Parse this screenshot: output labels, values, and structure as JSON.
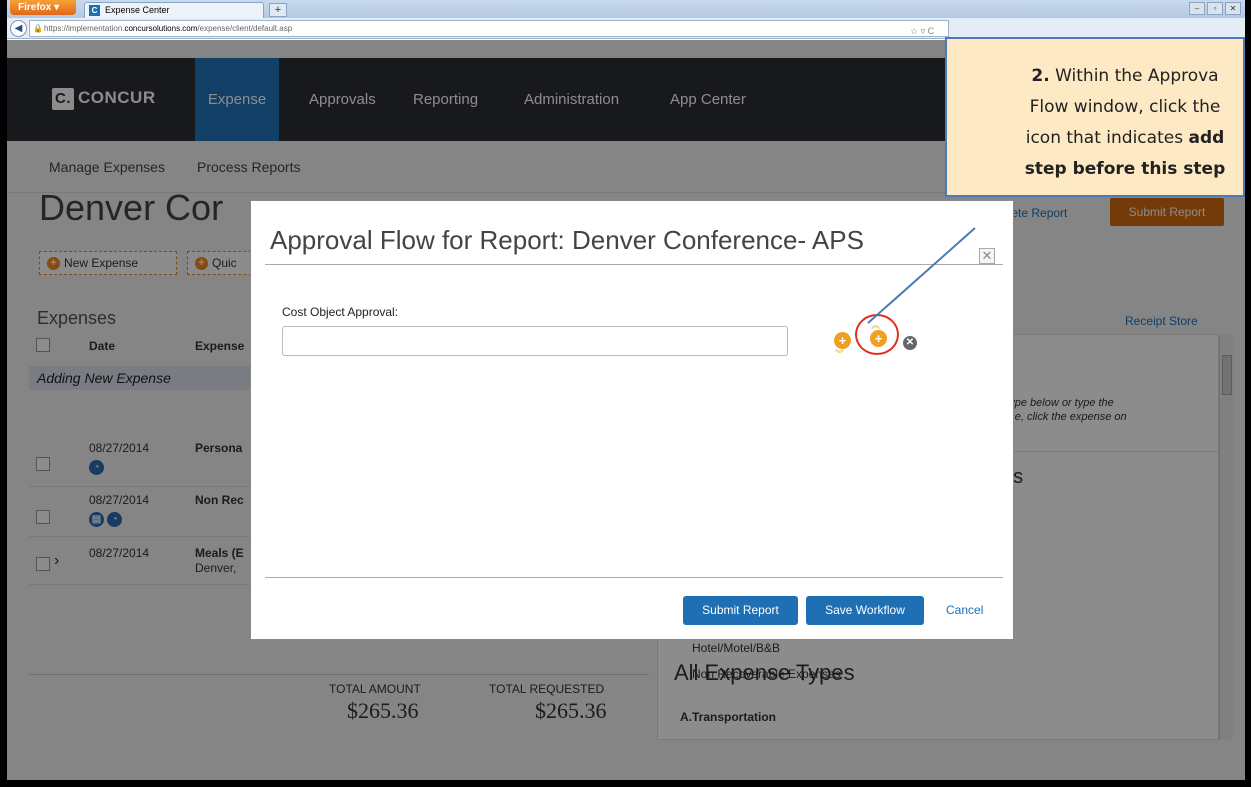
{
  "browser": {
    "app_button": "Firefox",
    "tab_title": "Expense Center",
    "tab_favicon": "C",
    "new_tab": "+",
    "url_prefix": "https://implementation.",
    "url_domain": "concursolutions.com",
    "url_path": "/expense/client/default.asp",
    "window_controls": [
      "–",
      "▫",
      "✕"
    ]
  },
  "app": {
    "logo_text": "CONCUR",
    "logo_mark": "C.",
    "nav": [
      "Expense",
      "Approvals",
      "Reporting",
      "Administration",
      "App Center"
    ],
    "active_nav": "Expense",
    "subnav": [
      "Manage Expenses",
      "Process Reports"
    ]
  },
  "report": {
    "title": "Denver Cor",
    "buttons": {
      "new_expense": "New Expense",
      "quick": "Quic"
    },
    "delete_link": "elete Report",
    "submit_button": "Submit Report",
    "receipt_store": "Receipt Store"
  },
  "expenses": {
    "heading": "Expenses",
    "headers": {
      "date": "Date",
      "expense_type": "Expense"
    },
    "adding_row": "Adding New Expense",
    "rows": [
      {
        "date": "08/27/2014",
        "type": "Persona",
        "sub": ""
      },
      {
        "date": "08/27/2014",
        "type": "Non Rec",
        "sub": ""
      },
      {
        "date": "08/27/2014",
        "type": "Meals (E",
        "sub": "Denver, "
      }
    ],
    "total_amount_label": "TOTAL AMOUNT",
    "total_amount": "$265.36",
    "total_requested_label": "TOTAL REQUESTED",
    "total_requested": "$265.36"
  },
  "right_panel": {
    "hint_line1": "e type below or type the",
    "hint_line2": "ense, click the expense on",
    "partial_heading": "es",
    "items": [
      "Hotel/Motel/B&B",
      "Non Recoverable Expenses"
    ],
    "all_types": "All Expense Types",
    "first_category": "A.Transportation"
  },
  "modal": {
    "title": "Approval Flow for Report: Denver Conference- APS",
    "close": "✕",
    "field_label": "Cost Object Approval:",
    "field_value": "",
    "submit_button": "Submit Report",
    "save_button": "Save Workflow",
    "cancel_link": "Cancel"
  },
  "callout": {
    "step_number": "2.",
    "text_1": " Within the Approva",
    "text_2": "Flow window, click the",
    "text_3": "icon that indicates ",
    "text_3_bold": "add",
    "text_4_bold": "step before this step"
  },
  "colors": {
    "brand_blue": "#1f73b8",
    "nav_dark": "#2b2f33",
    "accent_orange": "#f0a020",
    "highlight_red": "#e0301e",
    "callout_bg": "#fde9c4"
  }
}
